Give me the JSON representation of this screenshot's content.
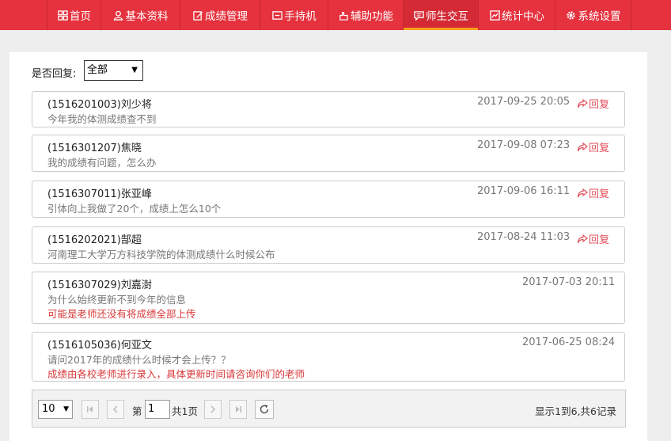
{
  "nav": {
    "items": [
      {
        "label": "首页",
        "icon": "grid-icon"
      },
      {
        "label": "基本资料",
        "icon": "user-icon"
      },
      {
        "label": "成绩管理",
        "icon": "edit-icon"
      },
      {
        "label": "手持机",
        "icon": "device-icon"
      },
      {
        "label": "辅助功能",
        "icon": "hand-icon"
      },
      {
        "label": "师生交互",
        "icon": "chat-icon"
      },
      {
        "label": "统计中心",
        "icon": "chart-icon"
      },
      {
        "label": "系统设置",
        "icon": "gear-icon"
      }
    ],
    "active_index": 5
  },
  "filter": {
    "label": "是否回复:",
    "selected": "全部"
  },
  "messages": [
    {
      "student": "(1516201003)刘少将",
      "time": "2017-09-25 20:05",
      "question": "今年我的体测成绩查不到",
      "answer": "",
      "reply_label": "回复"
    },
    {
      "student": "(1516301207)焦晓",
      "time": "2017-09-08 07:23",
      "question": "我的成绩有问题，怎么办",
      "answer": "",
      "reply_label": "回复"
    },
    {
      "student": "(1516307011)张亚峰",
      "time": "2017-09-06 16:11",
      "question": "引体向上我做了20个，成绩上怎么10个",
      "answer": "",
      "reply_label": "回复"
    },
    {
      "student": "(1516202021)郜超",
      "time": "2017-08-24 11:03",
      "question": "河南理工大学万方科技学院的体测成绩什么时候公布",
      "answer": "",
      "reply_label": "回复"
    },
    {
      "student": "(1516307029)刘嘉澍",
      "time": "2017-07-03 20:11",
      "question": "为什么始终更新不到今年的信息",
      "answer": "可能是老师还没有将成绩全部上传",
      "reply_label": ""
    },
    {
      "student": "(1516105036)何亚文",
      "time": "2017-06-25 08:24",
      "question": "请问2017年的成绩什么时候才会上传？？",
      "answer": "成绩由各校老师进行录入，具体更新时间请咨询你们的老师",
      "reply_label": ""
    }
  ],
  "pager": {
    "page_size": "10",
    "page_prefix": "第",
    "current_page": "1",
    "total_pages_text": "共1页",
    "summary": "显示1到6,共6记录"
  },
  "colors": {
    "nav_bg": "#e5323e",
    "active_underline": "#f7a11a",
    "reply_red": "#d9383a"
  }
}
